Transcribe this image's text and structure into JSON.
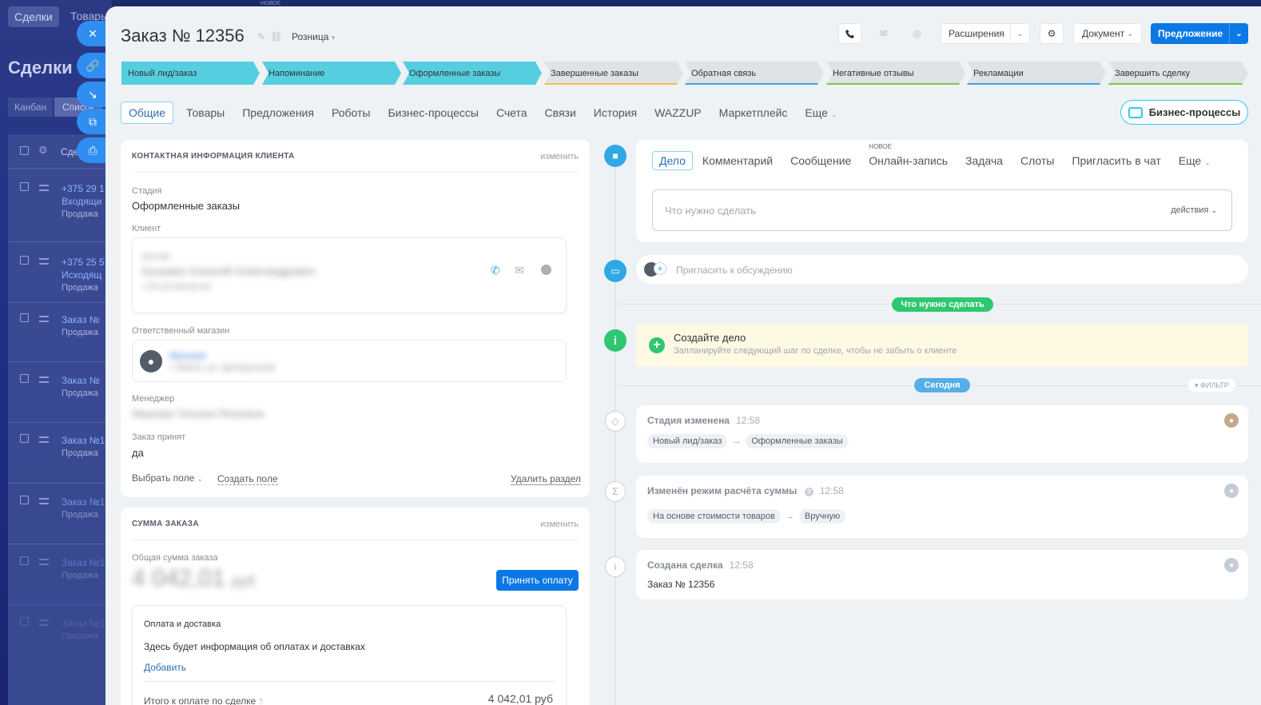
{
  "background": {
    "top_tab": "Сделки",
    "top_tab2": "Товары",
    "heading": "Сделки",
    "view_kanban": "Канбан",
    "view_list": "Список",
    "col_header": "Сде",
    "rows": [
      {
        "title": "+375 29 1",
        "sub1": "Входящи",
        "sub2": "Продажа"
      },
      {
        "title": "+375 25 5",
        "sub1": "Исходящ",
        "sub2": "Продажа"
      },
      {
        "title": "Заказ №",
        "sub1": "",
        "sub2": "Продажа"
      },
      {
        "title": "Заказ №",
        "sub1": "",
        "sub2": "Продажа"
      },
      {
        "title": "Заказ №1",
        "sub1": "",
        "sub2": "Продажа"
      },
      {
        "title": "Заказ №1",
        "sub1": "",
        "sub2": "Продажа"
      },
      {
        "title": "Заказ №1",
        "sub1": "",
        "sub2": "Продажа"
      },
      {
        "title": "Заказ №1",
        "sub1": "",
        "sub2": "Продажа"
      }
    ],
    "new_badge": "НОВОЕ"
  },
  "header": {
    "title": "Заказ № 12356",
    "category": "Розница",
    "extensions": "Расширения",
    "document": "Документ",
    "offer": "Предложение"
  },
  "stages": [
    {
      "label": "Новый лид/заказ",
      "active": true,
      "color": "#55cfe0"
    },
    {
      "label": "Напоминание",
      "active": true,
      "color": "#55cfe0"
    },
    {
      "label": "Оформленные заказы",
      "active": true,
      "color": "#55cfe0"
    },
    {
      "label": "Завершенные заказы",
      "active": false,
      "color": "#f0c04b"
    },
    {
      "label": "Обратная связь",
      "active": false,
      "color": "#3ba5e0"
    },
    {
      "label": "Негативные отзывы",
      "active": false,
      "color": "#7ac943"
    },
    {
      "label": "Рекламации",
      "active": false,
      "color": "#3ba5e0"
    },
    {
      "label": "Завершить сделку",
      "active": false,
      "color": "#7ac943"
    }
  ],
  "tabs": [
    "Общие",
    "Товары",
    "Предложения",
    "Роботы",
    "Бизнес-процессы",
    "Счета",
    "Связи",
    "История",
    "WAZZUP",
    "Маркетплейс",
    "Еще"
  ],
  "bp_button": "Бизнес-процессы",
  "contact_card": {
    "caption": "КОНТАКТНАЯ ИНФОРМАЦИЯ КЛИЕНТА",
    "edit": "изменить",
    "stage_label": "Стадия",
    "stage_value": "Оформленные заказы",
    "client_label": "Клиент",
    "client_name": "Кузьмин Алексей Александрович",
    "client_role": "Контакт",
    "client_phone": "+375 29 000-00-00",
    "shop_label": "Ответственный магазин",
    "shop_name": "Магазин",
    "shop_address": "г. Минск, ул. Центральная",
    "manager_label": "Менеджер",
    "manager_value": "Иванова Татьяна Петровна",
    "accepted_label": "Заказ принят",
    "accepted_value": "да",
    "choose_field": "Выбрать поле",
    "create_field": "Создать поле",
    "delete_section": "Удалить раздел"
  },
  "sum_card": {
    "caption": "СУММА ЗАКАЗА",
    "edit": "изменить",
    "total_label": "Общая сумма заказа",
    "total_value": "4 042,01",
    "currency": "руб",
    "accept_payment": "Принять оплату",
    "payment_title": "Оплата и доставка",
    "payment_text": "Здесь будет информация об оплатах и доставках",
    "add": "Добавить",
    "to_pay_label": "Итого к оплате по сделке",
    "to_pay_value": "4 042,01 руб"
  },
  "activity": {
    "tabs": [
      "Дело",
      "Комментарий",
      "Сообщение",
      "Онлайн-запись",
      "Задача",
      "Слоты",
      "Пригласить в чат",
      "Еще"
    ],
    "new_label": "НОВОЕ",
    "placeholder": "Что нужно сделать",
    "actions": "действия",
    "invite": "Пригласить к обсуждению",
    "todo_pill": "Что нужно сделать",
    "create_title": "Создайте дело",
    "create_text": "Запланируйте следующий шаг по сделке, чтобы не забыть о клиенте",
    "today_pill": "Сегодня",
    "filter": "ФИЛЬТР"
  },
  "events": [
    {
      "title": "Стадия изменена",
      "time": "12:58",
      "from": "Новый лид/заказ",
      "to": "Оформленные заказы"
    },
    {
      "title": "Изменён режим расчёта суммы",
      "time": "12:58",
      "from": "На основе стоимости товаров",
      "to": "Вручную"
    },
    {
      "title": "Создана сделка",
      "time": "12:58",
      "text": "Заказ № 12356"
    }
  ],
  "colors": {
    "accent": "#0b78e5",
    "stage_active": "#55cfe0",
    "success": "#2fc770",
    "today": "#55aee8"
  }
}
